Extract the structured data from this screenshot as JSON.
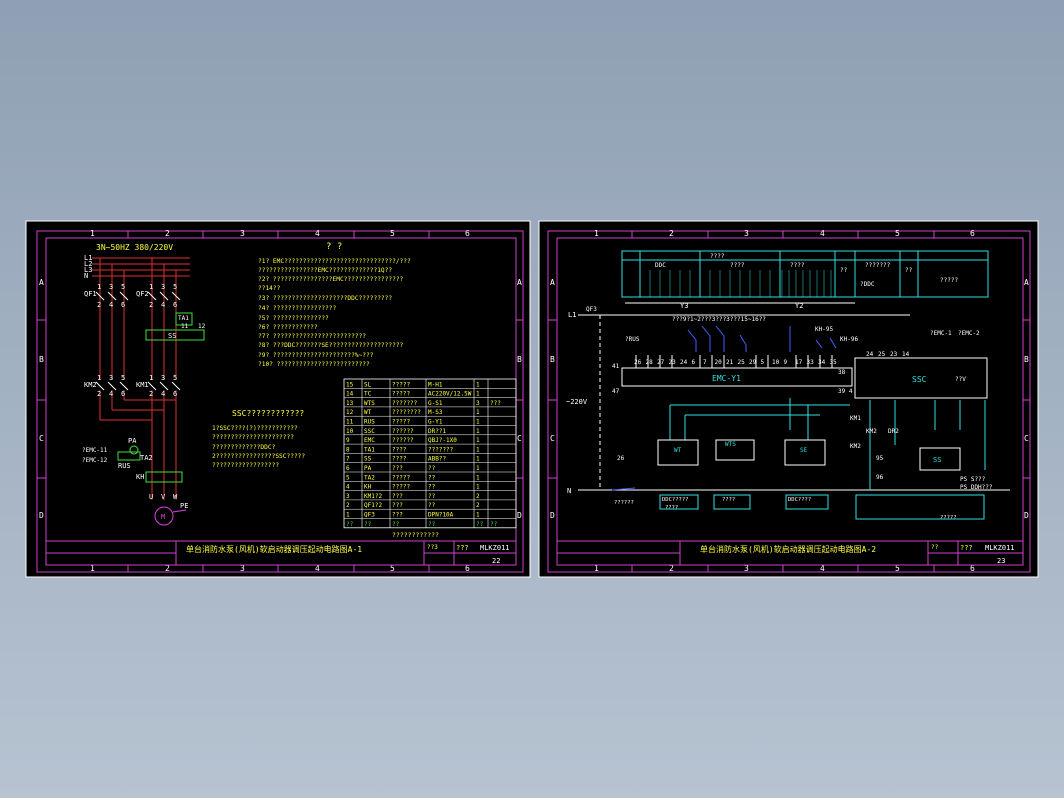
{
  "sheets": [
    {
      "id": "A1",
      "col_numbers": [
        "1",
        "2",
        "3",
        "4",
        "5",
        "6"
      ],
      "row_letters": [
        "A",
        "B",
        "C",
        "D"
      ],
      "title": "单台消防水泵(风机)软启动器调压起动电路图A-1",
      "code": "MLKZ011",
      "page": "22",
      "tb_small_1": "??3",
      "tb_small_2": "???",
      "supply": "3N~50HZ 380/220V",
      "bus_labels": [
        "L1",
        "L2",
        "L3",
        "N"
      ],
      "devices": {
        "qf1": "QF1",
        "qf2": "QF2",
        "km2": "KM2",
        "km1": "KM1",
        "ta1": "TA1",
        "n11": "11",
        "n12": "12",
        "ss": "SS",
        "pa": "PA",
        "ta2": "TA2",
        "rus": "RUS",
        "emc11": "?EMC-11",
        "emc12": "?EMC-12",
        "kh": "KH",
        "motor": "M",
        "pe": "PE",
        "uvw": [
          "U",
          "V",
          "W"
        ],
        "pins_top": [
          "1",
          "3",
          "5",
          "1",
          "3",
          "5"
        ],
        "pins_bot": [
          "2",
          "4",
          "6",
          "2",
          "4",
          "6"
        ]
      },
      "notes_title": "?          ?",
      "notes": [
        "?1?  EMC??????????????????????????????/???",
        "     ????????????????EMC?????????????1Q??",
        "?2?  ????????????????EMC????????????????",
        "     ??14??",
        "?3?  ????????????????????DDC?????????",
        "?4?  ?????????????????",
        "?5?  ???????????????",
        "?6?  ????????????",
        "?7?  ?????????????????????????",
        "?8?  ???DDC???????SE????????????????????",
        "?9?  ??????????????????????%~???",
        "?10? ?????????????????????????"
      ],
      "ssc_title": "SSC????????????",
      "ssc_notes": [
        "1?SSC????(?)???????????",
        "  ??????????????????????",
        "  ?????????????DDC?",
        "2????????????????SSC?????",
        "  ??????????????????"
      ],
      "parts_table": [
        [
          "15",
          "SL",
          "?????",
          "M-H1",
          "1",
          ""
        ],
        [
          "14",
          "TC",
          "?????",
          "AC220V/12.5W",
          "1",
          ""
        ],
        [
          "13",
          "WTS",
          "???????",
          "G-S1",
          "3",
          "???"
        ],
        [
          "12",
          "WT",
          "????????",
          "M-S3",
          "1",
          ""
        ],
        [
          "11",
          "RUS",
          "?????",
          "G-Y1",
          "1",
          ""
        ],
        [
          "10",
          "SSC",
          "??????",
          "DR??1",
          "1",
          ""
        ],
        [
          "9",
          "EMC",
          "??????",
          "QBJ?-1X0",
          "1",
          ""
        ],
        [
          "8",
          "TA1",
          "????",
          "???????",
          "1",
          ""
        ],
        [
          "7",
          "SS",
          "????",
          "ABB??",
          "1",
          ""
        ],
        [
          "6",
          "PA",
          "???",
          "??",
          "1",
          ""
        ],
        [
          "5",
          "TA2",
          "?????",
          "??",
          "1",
          ""
        ],
        [
          "4",
          "KH",
          "?????",
          "??",
          "1",
          ""
        ],
        [
          "3",
          "KM1?2",
          "???",
          "??",
          "2",
          ""
        ],
        [
          "2",
          "QF1?2",
          "???",
          "??",
          "2",
          ""
        ],
        [
          "1",
          "QF3",
          "???",
          "DPN?10A",
          "1",
          ""
        ],
        [
          "??",
          "??",
          "??",
          "??",
          "??",
          "??"
        ]
      ],
      "table_footer": "????????????"
    },
    {
      "id": "A2",
      "col_numbers": [
        "1",
        "2",
        "3",
        "4",
        "5",
        "6"
      ],
      "row_letters": [
        "A",
        "B",
        "C",
        "D"
      ],
      "title": "单台消防水泵(风机)软启动器调压起动电路图A-2",
      "code": "MLKZ011",
      "page": "23",
      "tb_small_1": "??",
      "tb_small_2": "???",
      "header_labels": [
        "DDC",
        "????",
        "????",
        "????",
        "??",
        "???????",
        "??",
        "?????",
        "?DDC"
      ],
      "dim_labels": [
        "Y3",
        "Y2"
      ],
      "voltage": "~220V",
      "l1": "L1",
      "n": "N",
      "qf3": "QF3",
      "rus": "?RUS",
      "emc_box": "EMC-Y1",
      "ssc_box": "SSC",
      "ssc_out": "??V",
      "emc_ref1": "?EMC-1",
      "emc_ref2": "?EMC-2",
      "kh": "KH-95",
      "kh2": "KH-96",
      "note_top": "???9?1~2???3???3???15~16??",
      "term_row1": [
        "26",
        "28",
        "27",
        "23",
        "24",
        "6",
        "7",
        "20",
        "21",
        "25",
        "29",
        "5",
        "10",
        "9",
        "17",
        "33",
        "34",
        "35"
      ],
      "term_row2": [
        "24",
        "25",
        "23",
        "14"
      ],
      "n41": "41",
      "n47": "47",
      "n38": "38",
      "n394": "39 4",
      "km1": "KM1",
      "km2": "KM2",
      "km1b": "KM2",
      "dr2": "DR2",
      "n95": "95",
      "n96": "96",
      "wt": "WT",
      "wts": "WTS",
      "se": "SE",
      "ss": "SS",
      "ps1": "PS S???",
      "ps2": "PS DDH???",
      "ddc_labels": [
        "DDC?????",
        "????",
        "DDC????"
      ],
      "bottom_labels": [
        "??????",
        "????",
        "?????"
      ],
      "n26": "26"
    }
  ],
  "colors": {
    "frame": "#d040d0",
    "title_text": "#ffff40",
    "text": "#ffff40",
    "wire_red": "#e03030",
    "wire_cyan": "#30e0e0",
    "wire_green": "#40e040",
    "white": "#ffffff",
    "magenta": "#e040e0"
  }
}
